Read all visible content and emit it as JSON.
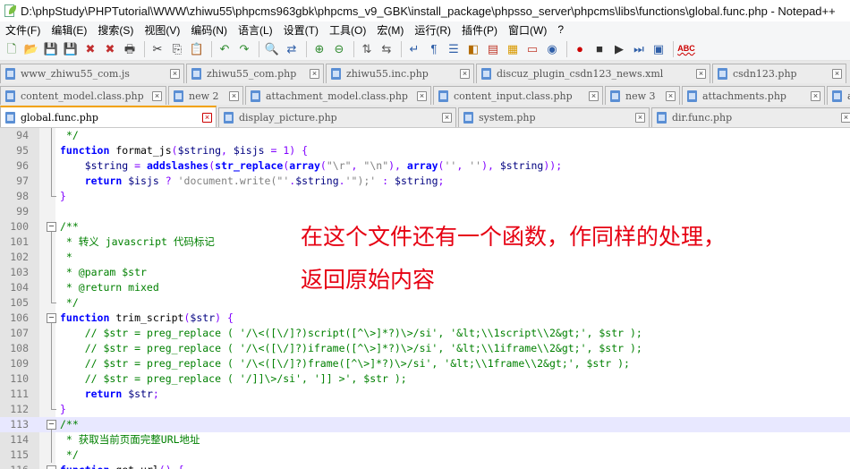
{
  "window": {
    "title": "D:\\phpStudy\\PHPTutorial\\WWW\\zhiwu55\\phpcms963gbk\\phpcms_v9_GBK\\install_package\\phpsso_server\\phpcms\\libs\\functions\\global.func.php - Notepad++"
  },
  "menu": [
    "文件(F)",
    "编辑(E)",
    "搜索(S)",
    "视图(V)",
    "编码(N)",
    "语言(L)",
    "设置(T)",
    "工具(O)",
    "宏(M)",
    "运行(R)",
    "插件(P)",
    "窗口(W)",
    "?"
  ],
  "toolbar": [
    {
      "name": "new-file-icon",
      "glyph": "🗋",
      "color": "#3a7d2c"
    },
    {
      "name": "open-file-icon",
      "glyph": "📂",
      "color": "#d9a300"
    },
    {
      "name": "save-icon",
      "glyph": "💾",
      "color": "#2f5fa8"
    },
    {
      "name": "save-all-icon",
      "glyph": "💾",
      "color": "#2f5fa8"
    },
    {
      "name": "close-icon",
      "glyph": "✖",
      "color": "#c23030"
    },
    {
      "name": "close-all-icon",
      "glyph": "✖",
      "color": "#c23030"
    },
    {
      "name": "print-icon",
      "glyph": "🖶",
      "color": "#444444"
    },
    {
      "sep": true
    },
    {
      "name": "cut-icon",
      "glyph": "✂",
      "color": "#333333"
    },
    {
      "name": "copy-icon",
      "glyph": "⎘",
      "color": "#333333"
    },
    {
      "name": "paste-icon",
      "glyph": "📋",
      "color": "#a0702a"
    },
    {
      "sep": true
    },
    {
      "name": "undo-icon",
      "glyph": "↶",
      "color": "#2e8b2e"
    },
    {
      "name": "redo-icon",
      "glyph": "↷",
      "color": "#2e8b2e"
    },
    {
      "sep": true
    },
    {
      "name": "find-icon",
      "glyph": "🔍",
      "color": "#333333"
    },
    {
      "name": "replace-icon",
      "glyph": "⇄",
      "color": "#2f5fa8"
    },
    {
      "sep": true
    },
    {
      "name": "zoom-in-icon",
      "glyph": "⊕",
      "color": "#2f8a2f"
    },
    {
      "name": "zoom-out-icon",
      "glyph": "⊖",
      "color": "#2f8a2f"
    },
    {
      "sep": true
    },
    {
      "name": "sync-vertical-icon",
      "glyph": "⇅",
      "color": "#555555"
    },
    {
      "name": "sync-horizontal-icon",
      "glyph": "⇆",
      "color": "#555555"
    },
    {
      "sep": true
    },
    {
      "name": "word-wrap-icon",
      "glyph": "↵",
      "color": "#2f5fa8"
    },
    {
      "name": "show-all-chars-icon",
      "glyph": "¶",
      "color": "#2f5fa8"
    },
    {
      "name": "indent-guide-icon",
      "glyph": "☰",
      "color": "#2f5fa8"
    },
    {
      "name": "udl-icon",
      "glyph": "◧",
      "color": "#b36b00"
    },
    {
      "name": "doc-map-icon",
      "glyph": "▤",
      "color": "#c0392b"
    },
    {
      "name": "function-list-icon",
      "glyph": "▦",
      "color": "#d99a00"
    },
    {
      "name": "folder-workspace-icon",
      "glyph": "▭",
      "color": "#c0392b"
    },
    {
      "name": "monitor-icon",
      "glyph": "◉",
      "color": "#2f5fa8"
    },
    {
      "sep": true
    },
    {
      "name": "record-macro-icon",
      "glyph": "●",
      "color": "#cc0000"
    },
    {
      "name": "stop-record-icon",
      "glyph": "■",
      "color": "#333333"
    },
    {
      "name": "play-macro-icon",
      "glyph": "▶",
      "color": "#333333"
    },
    {
      "name": "run-macro-multiple-icon",
      "glyph": "⏭",
      "color": "#2f5fa8"
    },
    {
      "name": "save-macro-icon",
      "glyph": "▣",
      "color": "#2f5fa8"
    },
    {
      "sep": true
    },
    {
      "name": "spell-check-icon",
      "glyph": "ABC",
      "color": "#cc0000"
    }
  ],
  "tabs_row1": [
    {
      "label": "www_zhiwu55_com.js",
      "width": 206
    },
    {
      "label": "zhiwu55_com.php",
      "width": 154
    },
    {
      "label": "zhiwu55.inc.php",
      "width": 166
    },
    {
      "label": "discuz_plugin_csdn123_news.xml",
      "width": 262
    },
    {
      "label": "csdn123.php",
      "width": 150
    }
  ],
  "tabs_row2": [
    {
      "label": "content_model.class.php",
      "width": 186
    },
    {
      "label": "new 2",
      "width": 84
    },
    {
      "label": "attachment_model.class.php",
      "width": 208
    },
    {
      "label": "content_input.class.php",
      "width": 190
    },
    {
      "label": "new 3",
      "width": 84
    },
    {
      "label": "attachments.php",
      "width": 160
    },
    {
      "label": "att",
      "width": 60
    }
  ],
  "tabs_row3": [
    {
      "label": "global.func.php",
      "width": 242,
      "active": true
    },
    {
      "label": "display_picture.php",
      "width": 266
    },
    {
      "label": "system.php",
      "width": 214
    },
    {
      "label": "dir.func.php",
      "width": 228
    }
  ],
  "editor": {
    "current_line": 113,
    "lines": [
      {
        "n": "94",
        "fold": "line",
        "html": " <span class=\"cm\">*/</span>"
      },
      {
        "n": "95",
        "fold": "line",
        "html": "<span class=\"kw\">function</span> format_js<span class=\"op\">(</span><span class=\"vr\">$string</span><span class=\"op\">,</span> <span class=\"vr\">$isjs</span> <span class=\"op\">=</span> <span class=\"op\">1)</span> <span class=\"op\">{</span>"
      },
      {
        "n": "96",
        "fold": "line",
        "html": "    <span class=\"vr\">$string</span> <span class=\"op\">=</span> <span class=\"kw\">addslashes</span><span class=\"op\">(</span><span class=\"kw\">str_replace</span><span class=\"op\">(</span><span class=\"kw\">array</span><span class=\"op\">(</span><span class=\"st\">\"\\r\"</span><span class=\"op\">,</span> <span class=\"st\">\"\\n\"</span><span class=\"op\">),</span> <span class=\"kw\">array</span><span class=\"op\">(</span><span class=\"st\">''</span><span class=\"op\">,</span> <span class=\"st\">''</span><span class=\"op\">),</span> <span class=\"vr\">$string</span><span class=\"op\">));</span>"
      },
      {
        "n": "97",
        "fold": "line",
        "html": "    <span class=\"kw\">return</span> <span class=\"vr\">$isjs</span> <span class=\"op\">?</span> <span class=\"st\">'document.write(\"'</span><span class=\"op\">.</span><span class=\"vr\">$string</span><span class=\"op\">.</span><span class=\"st\">'\");'</span> <span class=\"op\">:</span> <span class=\"vr\">$string</span><span class=\"op\">;</span>"
      },
      {
        "n": "98",
        "fold": "end",
        "html": "<span class=\"op\">}</span>"
      },
      {
        "n": "99",
        "fold": "",
        "html": ""
      },
      {
        "n": "100",
        "fold": "open",
        "html": "<span class=\"cm\">/**</span>"
      },
      {
        "n": "101",
        "fold": "line",
        "html": "<span class=\"cm\"> * 转义 javascript 代码标记</span>"
      },
      {
        "n": "102",
        "fold": "line",
        "html": "<span class=\"cm\"> *</span>"
      },
      {
        "n": "103",
        "fold": "line",
        "html": "<span class=\"cm\"> * @param $str</span>"
      },
      {
        "n": "104",
        "fold": "line",
        "html": "<span class=\"cm\"> * @return mixed</span>"
      },
      {
        "n": "105",
        "fold": "end",
        "html": "<span class=\"cm\"> */</span>"
      },
      {
        "n": "106",
        "fold": "open",
        "html": "<span class=\"kw\">function</span> trim_script<span class=\"op\">(</span><span class=\"vr\">$str</span><span class=\"op\">)</span> <span class=\"op\">{</span>"
      },
      {
        "n": "107",
        "fold": "line",
        "html": "    <span class=\"cm\">// $str = preg_replace ( '/\\&lt;([\\/]?)script([^\\&gt;]*?)\\&gt;/si', '&amp;lt;\\\\1script\\\\2&amp;gt;', $str );</span>"
      },
      {
        "n": "108",
        "fold": "line",
        "html": "    <span class=\"cm\">// $str = preg_replace ( '/\\&lt;([\\/]?)iframe([^\\&gt;]*?)\\&gt;/si', '&amp;lt;\\\\1iframe\\\\2&amp;gt;', $str );</span>"
      },
      {
        "n": "109",
        "fold": "line",
        "html": "    <span class=\"cm\">// $str = preg_replace ( '/\\&lt;([\\/]?)frame([^\\&gt;]*?)\\&gt;/si', '&amp;lt;\\\\1frame\\\\2&amp;gt;', $str );</span>"
      },
      {
        "n": "110",
        "fold": "line",
        "html": "    <span class=\"cm\">// $str = preg_replace ( '/]]\\&gt;/si', ']] &gt;', $str );</span>"
      },
      {
        "n": "111",
        "fold": "line",
        "html": "    <span class=\"kw\">return</span> <span class=\"vr\">$str</span><span class=\"op\">;</span>"
      },
      {
        "n": "112",
        "fold": "end",
        "html": "<span class=\"op\">}</span>"
      },
      {
        "n": "113",
        "fold": "open",
        "html": "<span class=\"cm\">/**</span>"
      },
      {
        "n": "114",
        "fold": "line",
        "html": "<span class=\"cm\"> * 获取当前页面完整URL地址</span>"
      },
      {
        "n": "115",
        "fold": "line",
        "html": "<span class=\"cm\"> */</span>"
      },
      {
        "n": "116",
        "fold": "open",
        "html": "<span class=\"kw\">function</span> get_url<span class=\"op\">()</span> <span class=\"op\">{</span>"
      }
    ]
  },
  "annotation": {
    "line1": "在这个文件还有一个函数，作同样的处理，",
    "line2": "返回原始内容",
    "color": "#e60012"
  }
}
